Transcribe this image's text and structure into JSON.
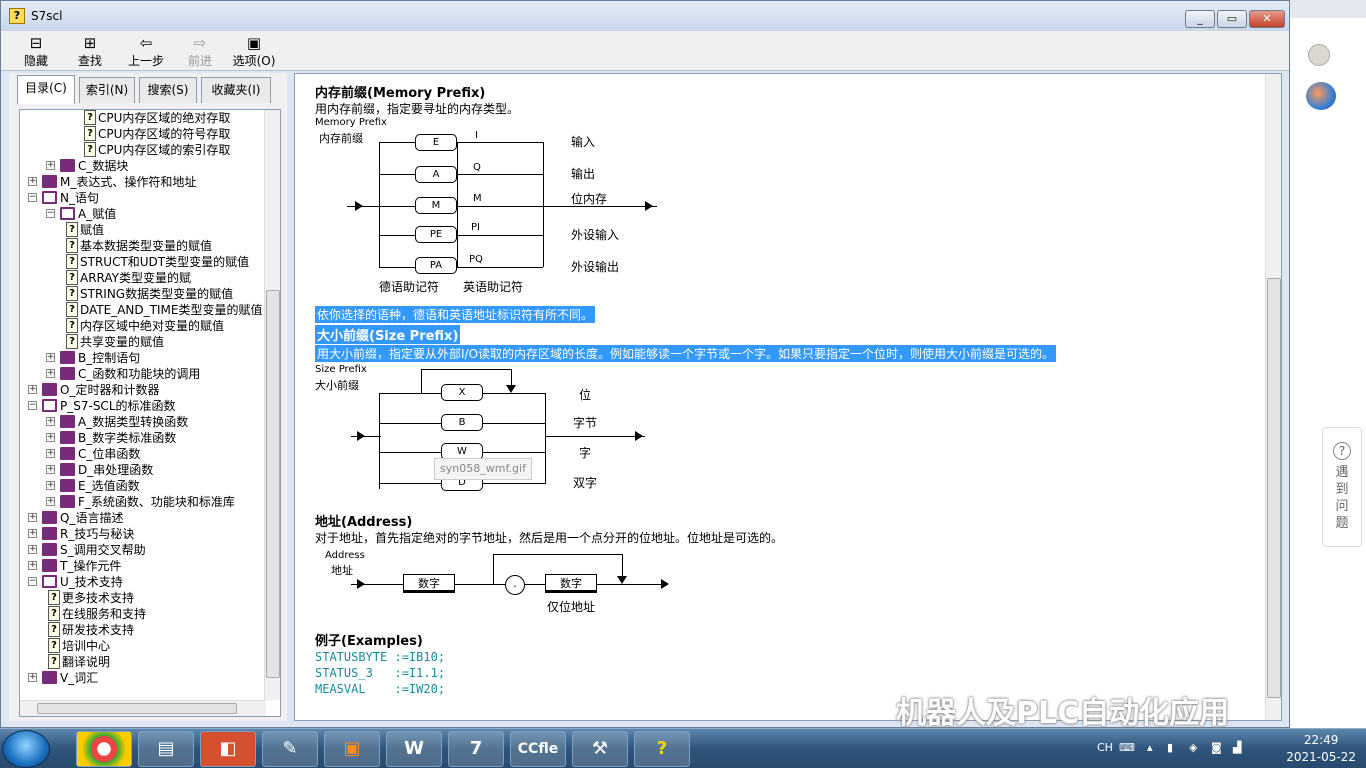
{
  "window": {
    "title": "S7scl",
    "app_icon": "?"
  },
  "toolbar": {
    "hide_label": "隐藏",
    "find_label": "查找",
    "back_label": "上一步",
    "forward_label": "前进",
    "options_label": "选项(O)"
  },
  "tabs": [
    "目录(C)",
    "索引(N)",
    "搜索(S)",
    "收藏夹(I)"
  ],
  "tree": [
    {
      "label": "CPU内存区域的绝对存取",
      "type": "page"
    },
    {
      "label": "CPU内存区域的符号存取",
      "type": "page"
    },
    {
      "label": "CPU内存区域的索引存取",
      "type": "page"
    },
    {
      "label": "C_数据块",
      "type": "book"
    },
    {
      "label": "M_表达式、操作符和地址",
      "type": "book"
    },
    {
      "label": "N_语句",
      "type": "open"
    },
    {
      "label": "A_赋值",
      "type": "open"
    },
    {
      "label": "赋值",
      "type": "page"
    },
    {
      "label": "基本数据类型变量的赋值",
      "type": "page"
    },
    {
      "label": "STRUCT和UDT类型变量的赋值",
      "type": "page"
    },
    {
      "label": "ARRAY类型变量的赋",
      "type": "page"
    },
    {
      "label": "STRING数据类型变量的赋值",
      "type": "page"
    },
    {
      "label": "DATE_AND_TIME类型变量的赋值",
      "type": "page"
    },
    {
      "label": "内存区域中绝对变量的赋值",
      "type": "page"
    },
    {
      "label": "共享变量的赋值",
      "type": "page"
    },
    {
      "label": "B_控制语句",
      "type": "book"
    },
    {
      "label": "C_函数和功能块的调用",
      "type": "book"
    },
    {
      "label": "O_定时器和计数器",
      "type": "book"
    },
    {
      "label": "P_S7-SCL的标准函数",
      "type": "open"
    },
    {
      "label": "A_数据类型转换函数",
      "type": "book"
    },
    {
      "label": "B_数字类标准函数",
      "type": "book"
    },
    {
      "label": "C_位串函数",
      "type": "book"
    },
    {
      "label": "D_串处理函数",
      "type": "book"
    },
    {
      "label": "E_选值函数",
      "type": "book"
    },
    {
      "label": "F_系统函数、功能块和标准库",
      "type": "book"
    },
    {
      "label": "Q_语言描述",
      "type": "book"
    },
    {
      "label": "R_技巧与秘诀",
      "type": "book"
    },
    {
      "label": "S_调用交叉帮助",
      "type": "book"
    },
    {
      "label": "T_操作元件",
      "type": "book"
    },
    {
      "label": "U_技术支持",
      "type": "open"
    },
    {
      "label": "更多技术支持",
      "type": "page"
    },
    {
      "label": "在线服务和支持",
      "type": "page"
    },
    {
      "label": "研发技术支持",
      "type": "page"
    },
    {
      "label": "培训中心",
      "type": "page"
    },
    {
      "label": "翻译说明",
      "type": "page"
    },
    {
      "label": "V_词汇",
      "type": "book"
    }
  ],
  "content": {
    "memory_prefix_title": "内存前缀(Memory Prefix)",
    "memory_prefix_desc": "用内存前缀，指定要寻址的内存类型。",
    "diagram1": {
      "label_en": "Memory Prefix",
      "label_cn": "内存前缀",
      "german": [
        "E",
        "A",
        "M",
        "PE",
        "PA"
      ],
      "english": [
        "I",
        "Q",
        "M",
        "PI",
        "PQ"
      ],
      "meanings": [
        "输入",
        "输出",
        "位内存",
        "外设输入",
        "外设输出"
      ],
      "german_caption": "德语助记符",
      "english_caption": "英语助记符"
    },
    "note_selected": "依你选择的语种，德语和英语地址标识符有所不同。",
    "size_prefix_title": "大小前缀(Size Prefix)",
    "size_prefix_desc": "用大小前缀，指定要从外部I/O读取的内存区域的长度。例如能够读一个字节或一个字。如果只要指定一个位时，则使用大小前缀是可选的。",
    "diagram2": {
      "label_en": "Size Prefix",
      "label_cn": "大小前缀",
      "boxes": [
        "X",
        "B",
        "W",
        "D"
      ],
      "meanings": [
        "位",
        "字节",
        "字",
        "双字"
      ],
      "tooltip": "syn058_wmf.gif"
    },
    "address_title": "地址(Address)",
    "address_desc": "对于地址，首先指定绝对的字节地址，然后是用一个点分开的位地址。位地址是可选的。",
    "diagram3": {
      "label_en": "Address",
      "label_cn": "地址",
      "box1": "数字",
      "box2": "数字",
      "dot": ".",
      "caption": "仅位地址"
    },
    "examples_title": "例子(Examples)",
    "examples": [
      "STATUSBYTE :=IB10;",
      "STATUS_3   :=I1.1;",
      "MEASVAL    :=IW20;"
    ]
  },
  "side_panel": {
    "feedback": "遇到问题",
    "help_icon": "?"
  },
  "watermark": "机器人及PLC自动化应用",
  "taskbar": {
    "apps": [
      "chrome",
      "explorer",
      "ppt",
      "sketch",
      "camera",
      "W",
      "s7",
      "CCfle",
      "tools",
      "help"
    ],
    "tray_lang": "CH",
    "time": "22:49",
    "date": "2021-05-22"
  }
}
